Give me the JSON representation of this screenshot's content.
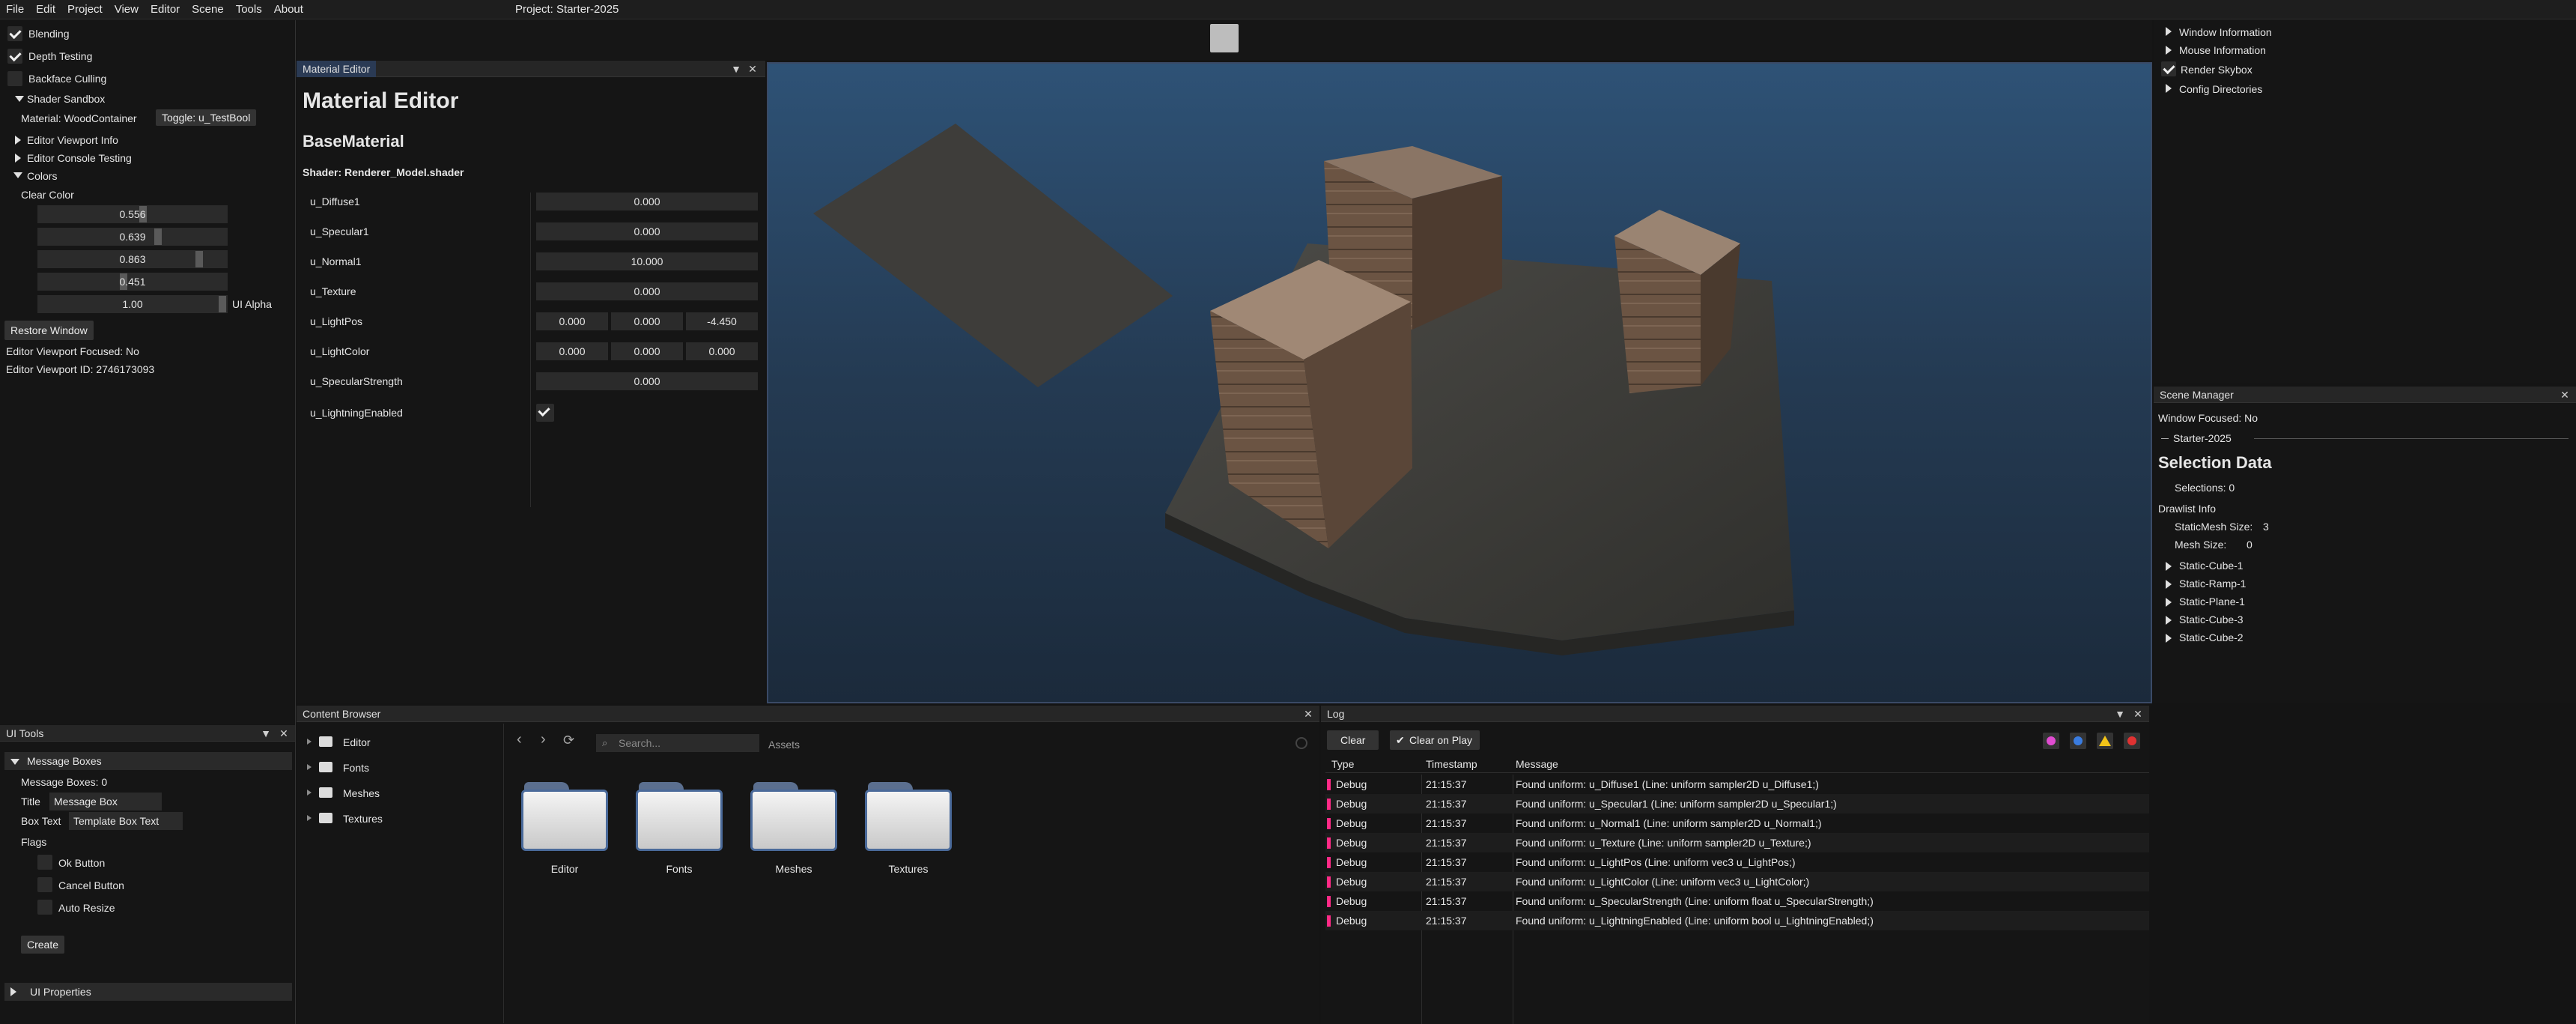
{
  "menu": [
    "File",
    "Edit",
    "Project",
    "View",
    "Editor",
    "Scene",
    "Tools",
    "About"
  ],
  "project_title": "Project: Starter-2025",
  "left_panel": {
    "blending": "Blending",
    "depth_testing": "Depth Testing",
    "backface_culling": "Backface Culling",
    "shader_sandbox": "Shader Sandbox",
    "material_label": "Material: WoodContainer",
    "toggle_button": "Toggle: u_TestBool",
    "viewport_info": "Editor Viewport Info",
    "console_testing": "Editor Console Testing",
    "colors": "Colors",
    "clear_color": "Clear Color",
    "color_values": [
      "0.556",
      "0.639",
      "0.863",
      "0.451"
    ],
    "color_fill": [
      0.556,
      0.639,
      0.863,
      0.451
    ],
    "alpha_value": "1.00",
    "alpha_label": "UI Alpha",
    "restore_window": "Restore Window",
    "viewport_focused": "Editor Viewport Focused: No",
    "viewport_id": "Editor Viewport ID: 2746173093"
  },
  "ui_tools": {
    "title": "UI Tools",
    "message_boxes": "Message Boxes",
    "message_boxes_count": "Message Boxes: 0",
    "title_label": "Title",
    "title_value": "Message Box",
    "box_text_label": "Box Text",
    "box_text_value": "Template Box Text",
    "flags": "Flags",
    "ok_button": "Ok Button",
    "cancel_button": "Cancel Button",
    "auto_resize": "Auto Resize",
    "create": "Create",
    "ui_properties": "UI Properties"
  },
  "material_editor": {
    "tab": "Material Editor",
    "heading": "Material Editor",
    "base": "BaseMaterial",
    "shader": "Shader: Renderer_Model.shader",
    "uniforms": [
      {
        "name": "u_Diffuse1",
        "values": [
          "0.000"
        ]
      },
      {
        "name": "u_Specular1",
        "values": [
          "0.000"
        ]
      },
      {
        "name": "u_Normal1",
        "values": [
          "10.000"
        ]
      },
      {
        "name": "u_Texture",
        "values": [
          "0.000"
        ]
      },
      {
        "name": "u_LightPos",
        "values": [
          "0.000",
          "0.000",
          "-4.450"
        ]
      },
      {
        "name": "u_LightColor",
        "values": [
          "0.000",
          "0.000",
          "0.000"
        ]
      },
      {
        "name": "u_SpecularStrength",
        "values": [
          "0.000"
        ]
      }
    ],
    "bool_uniform": "u_LightningEnabled"
  },
  "right_top": {
    "window_information": "Window Information",
    "mouse_information": "Mouse Information",
    "render_skybox": "Render Skybox",
    "config_directories": "Config Directories"
  },
  "scene_manager": {
    "tab": "Scene Manager",
    "window_focused": "Window Focused: No",
    "scene_name": "Starter-2025",
    "selection_data": "Selection Data",
    "selections": "Selections: 0",
    "drawlist_info": "Drawlist Info",
    "static_mesh_label": "StaticMesh Size:",
    "static_mesh_value": "3",
    "mesh_label": "Mesh Size:",
    "mesh_value": "0",
    "objects": [
      "Static-Cube-1",
      "Static-Ramp-1",
      "Static-Plane-1",
      "Static-Cube-3",
      "Static-Cube-2"
    ]
  },
  "content_browser": {
    "tab": "Content Browser",
    "tree": [
      "Editor",
      "Fonts",
      "Meshes",
      "Textures"
    ],
    "search_placeholder": "Search...",
    "path": "Assets",
    "folders": [
      "Editor",
      "Fonts",
      "Meshes",
      "Textures"
    ]
  },
  "log": {
    "tab": "Log",
    "clear": "Clear",
    "clear_on_play": "Clear on Play",
    "headers": [
      "Type",
      "Timestamp",
      "Message"
    ],
    "rows": [
      {
        "type": "Debug",
        "time": "21:15:37",
        "msg": "Found uniform: u_Diffuse1 (Line: uniform sampler2D u_Diffuse1;)"
      },
      {
        "type": "Debug",
        "time": "21:15:37",
        "msg": "Found uniform: u_Specular1 (Line: uniform sampler2D u_Specular1;)"
      },
      {
        "type": "Debug",
        "time": "21:15:37",
        "msg": "Found uniform: u_Normal1 (Line: uniform sampler2D u_Normal1;)"
      },
      {
        "type": "Debug",
        "time": "21:15:37",
        "msg": "Found uniform: u_Texture (Line: uniform sampler2D u_Texture;)"
      },
      {
        "type": "Debug",
        "time": "21:15:37",
        "msg": "Found uniform: u_LightPos (Line: uniform vec3 u_LightPos;)"
      },
      {
        "type": "Debug",
        "time": "21:15:37",
        "msg": "Found uniform: u_LightColor (Line: uniform vec3 u_LightColor;)"
      },
      {
        "type": "Debug",
        "time": "21:15:37",
        "msg": "Found uniform: u_SpecularStrength (Line: uniform float u_SpecularStrength;)"
      },
      {
        "type": "Debug",
        "time": "21:15:37",
        "msg": "Found uniform: u_LightningEnabled (Line: uniform bool u_LightningEnabled;)"
      }
    ]
  },
  "colors": {
    "accent": "#2a3a54",
    "debug": "#ff2a86",
    "warning": "#f2c318",
    "error": "#e03232",
    "info": "#3a7ce0"
  }
}
